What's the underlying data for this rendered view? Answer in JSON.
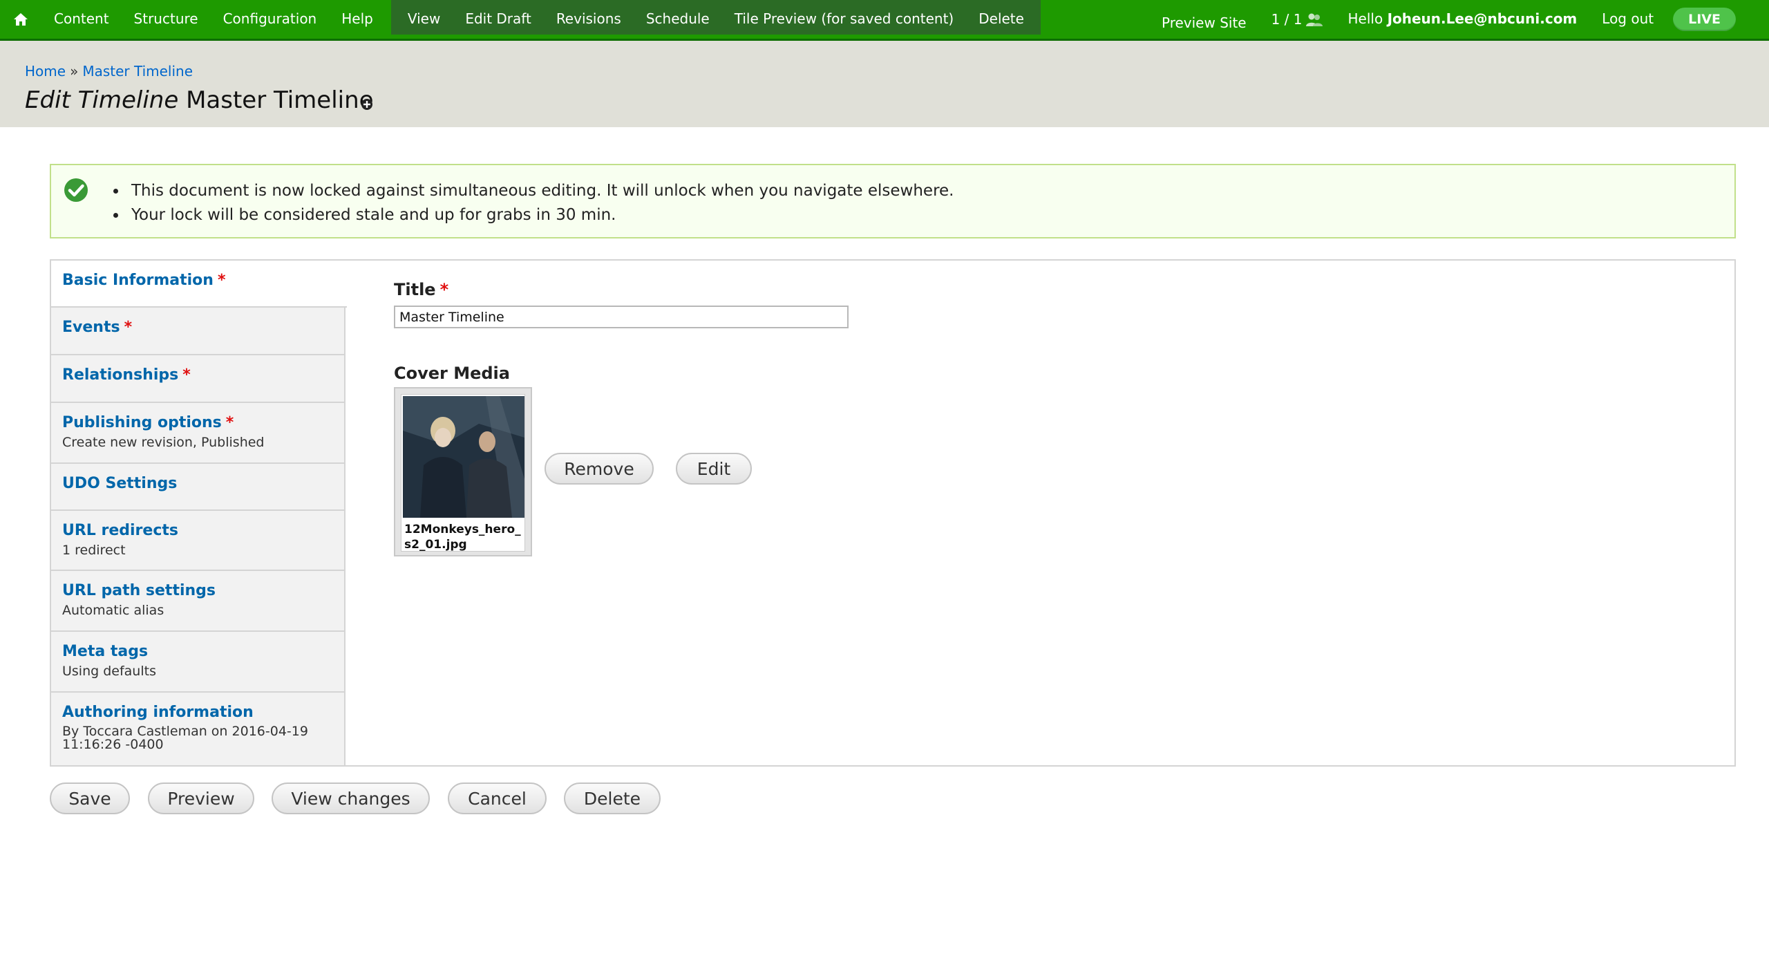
{
  "toolbar": {
    "menu": [
      "Content",
      "Structure",
      "Configuration",
      "Help"
    ],
    "tabs": [
      "View",
      "Edit Draft",
      "Revisions",
      "Schedule",
      "Tile Preview (for saved content)",
      "Delete"
    ],
    "preview_site": "Preview Site",
    "user_count": "1 / 1",
    "hello": "Hello",
    "username": "Joheun.Lee@nbcuni.com",
    "logout": "Log out",
    "live": "LIVE"
  },
  "header": {
    "breadcrumb_home": "Home",
    "breadcrumb_sep": "»",
    "breadcrumb_current": "Master Timeline",
    "title_prefix": "Edit Timeline",
    "title_name": "Master Timeline"
  },
  "messages": [
    "This document is now locked against simultaneous editing. It will unlock when you navigate elsewhere.",
    "Your lock will be considered stale and up for grabs in 30 min."
  ],
  "vertical_tabs": [
    {
      "label": "Basic Information",
      "required": "*",
      "summary": ""
    },
    {
      "label": "Events",
      "required": "*",
      "summary": ""
    },
    {
      "label": "Relationships",
      "required": "*",
      "summary": ""
    },
    {
      "label": "Publishing options",
      "required": "*",
      "summary": "Create new revision, Published"
    },
    {
      "label": "UDO Settings",
      "required": "",
      "summary": ""
    },
    {
      "label": "URL redirects",
      "required": "",
      "summary": "1 redirect"
    },
    {
      "label": "URL path settings",
      "required": "",
      "summary": "Automatic alias"
    },
    {
      "label": "Meta tags",
      "required": "",
      "summary": "Using defaults"
    },
    {
      "label": "Authoring information",
      "required": "",
      "summary": "By Toccara Castleman on 2016-04-19 11:16:26 -0400"
    }
  ],
  "form": {
    "title_label": "Title",
    "title_required": "*",
    "title_value": "Master Timeline",
    "cover_media_label": "Cover Media",
    "media_filename": "12Monkeys_hero_s2_01.jpg",
    "remove_label": "Remove",
    "edit_label": "Edit"
  },
  "actions": {
    "save": "Save",
    "preview": "Preview",
    "view_changes": "View changes",
    "cancel": "Cancel",
    "delete": "Delete"
  },
  "colors": {
    "toolbar_green": "#1e9a00",
    "link_blue": "#0066aa",
    "required_red": "#e01010",
    "status_green": "#c1e08a"
  }
}
